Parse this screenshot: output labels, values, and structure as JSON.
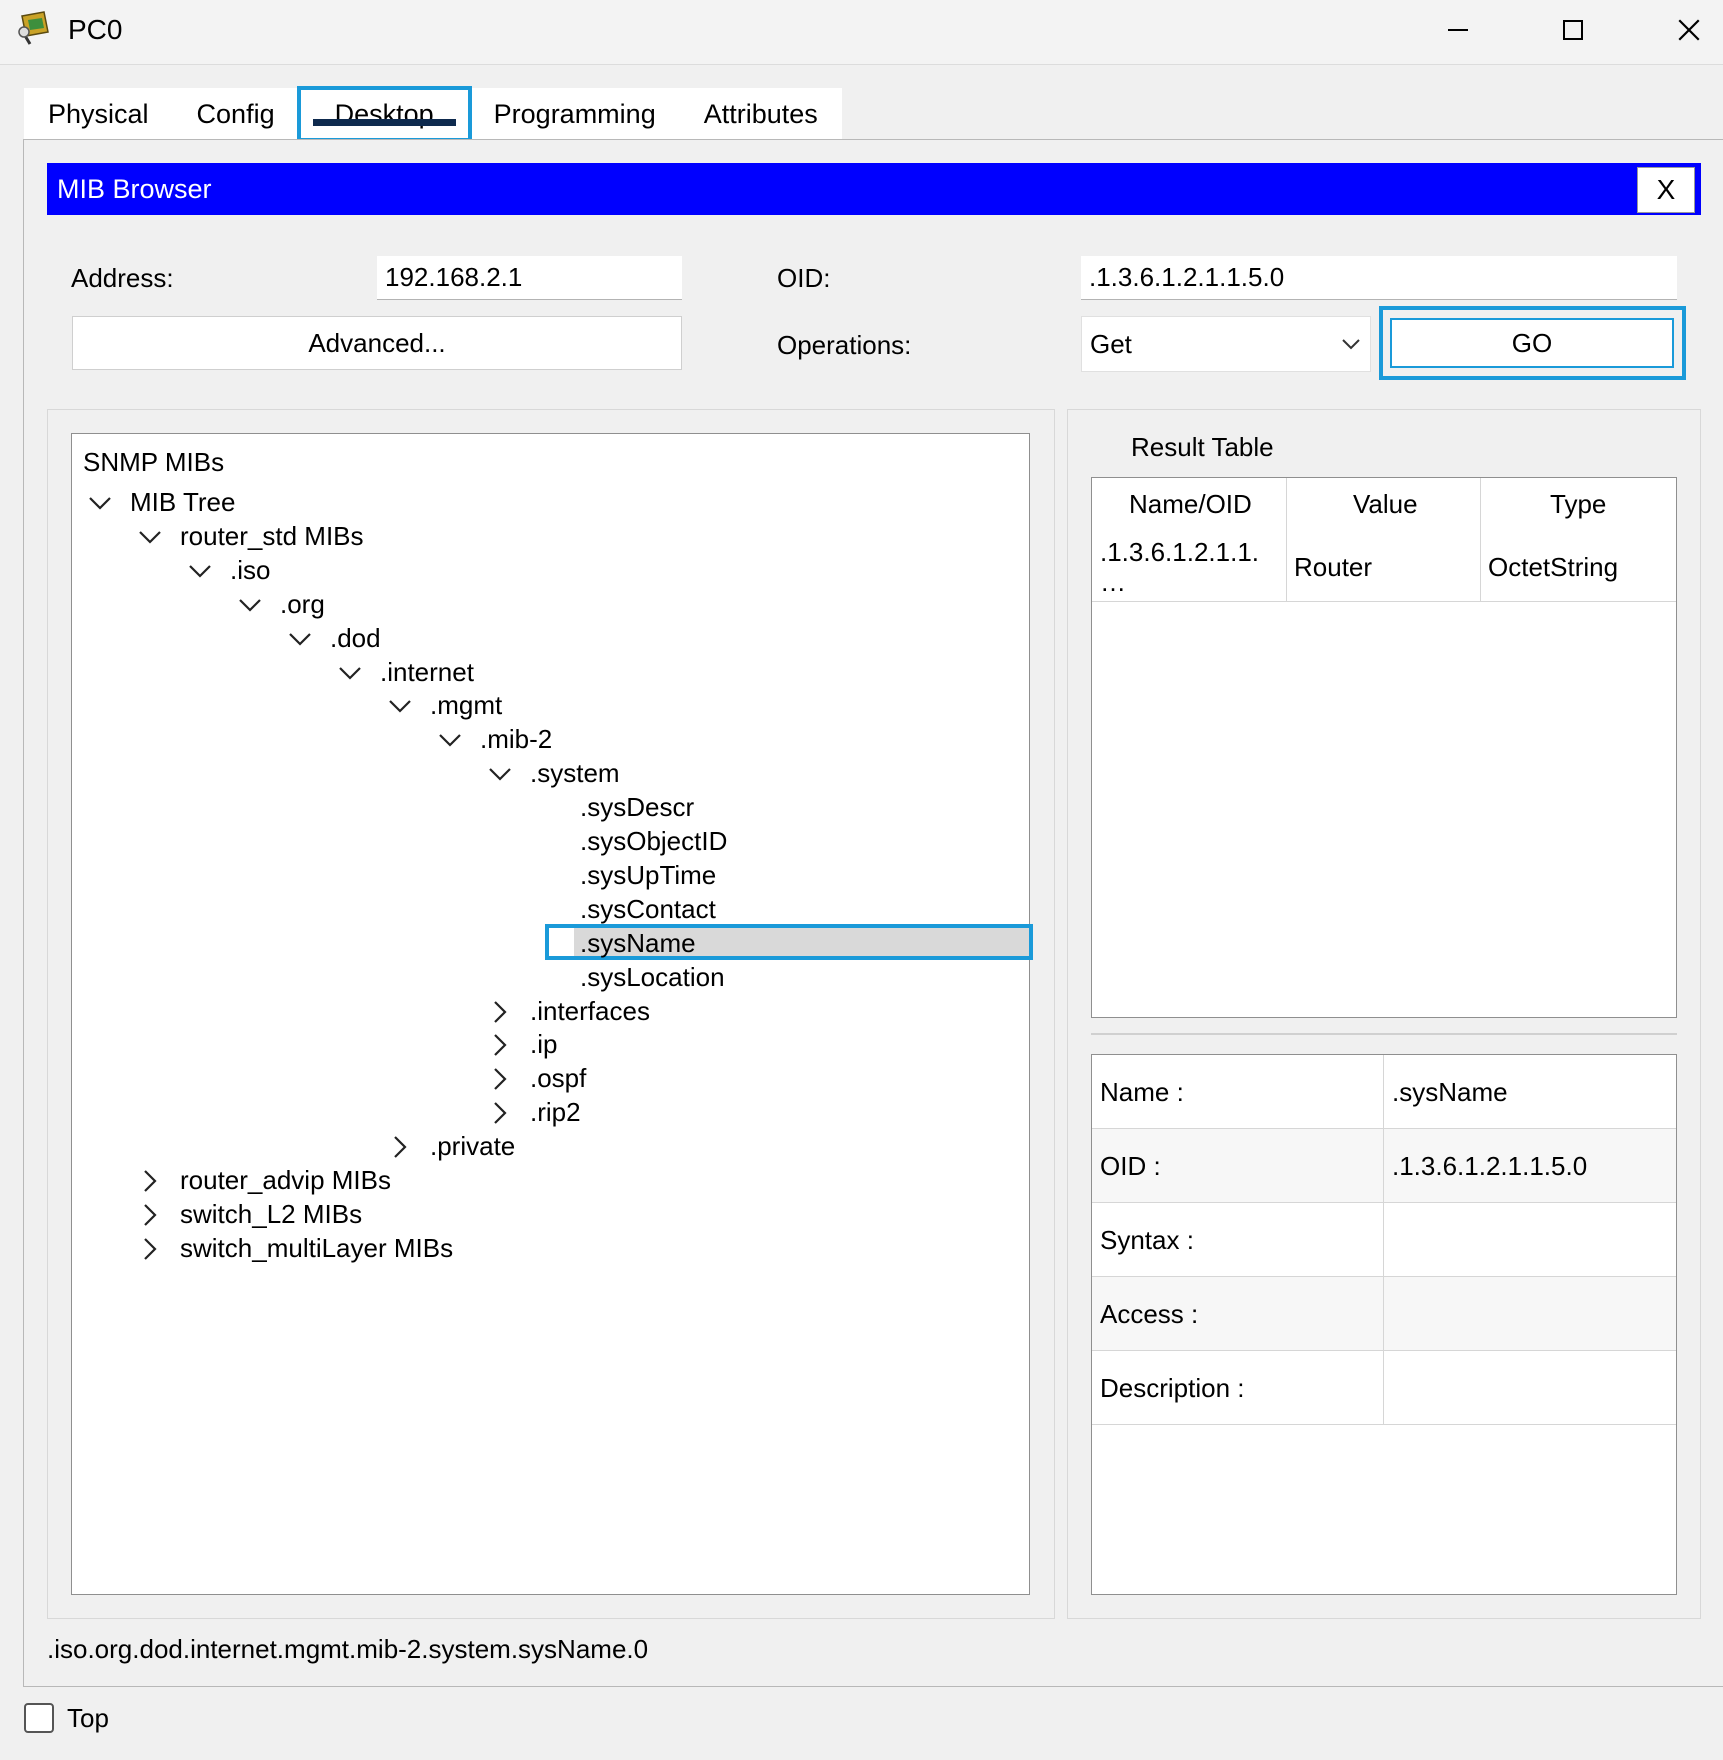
{
  "window": {
    "title": "PC0"
  },
  "tabs": [
    {
      "label": "Physical"
    },
    {
      "label": "Config"
    },
    {
      "label": "Desktop",
      "active": true
    },
    {
      "label": "Programming"
    },
    {
      "label": "Attributes"
    }
  ],
  "mib_browser": {
    "title": "MIB Browser",
    "close_label": "X",
    "address_label": "Address:",
    "address_value": "192.168.2.1",
    "oid_label": "OID:",
    "oid_value": ".1.3.6.1.2.1.1.5.0",
    "advanced_label": "Advanced...",
    "operations_label": "Operations:",
    "operation_selected": "Get",
    "go_label": "GO"
  },
  "tree": {
    "root_label": "SNMP MIBs",
    "nodes": [
      {
        "label": "MIB Tree",
        "state": "expanded"
      },
      {
        "label": "router_std MIBs",
        "state": "expanded"
      },
      {
        "label": ".iso",
        "state": "expanded"
      },
      {
        "label": ".org",
        "state": "expanded"
      },
      {
        "label": ".dod",
        "state": "expanded"
      },
      {
        "label": ".internet",
        "state": "expanded"
      },
      {
        "label": ".mgmt",
        "state": "expanded"
      },
      {
        "label": ".mib-2",
        "state": "expanded"
      },
      {
        "label": ".system",
        "state": "expanded"
      },
      {
        "label": ".sysDescr",
        "state": "leaf"
      },
      {
        "label": ".sysObjectID",
        "state": "leaf"
      },
      {
        "label": ".sysUpTime",
        "state": "leaf"
      },
      {
        "label": ".sysContact",
        "state": "leaf"
      },
      {
        "label": ".sysName",
        "state": "leaf",
        "selected": true
      },
      {
        "label": ".sysLocation",
        "state": "leaf"
      },
      {
        "label": ".interfaces",
        "state": "collapsed"
      },
      {
        "label": ".ip",
        "state": "collapsed"
      },
      {
        "label": ".ospf",
        "state": "collapsed"
      },
      {
        "label": ".rip2",
        "state": "collapsed"
      },
      {
        "label": ".private",
        "state": "collapsed"
      },
      {
        "label": "router_advip MIBs",
        "state": "collapsed"
      },
      {
        "label": "switch_L2 MIBs",
        "state": "collapsed"
      },
      {
        "label": "switch_multiLayer MIBs",
        "state": "collapsed"
      }
    ]
  },
  "result_table": {
    "title": "Result Table",
    "headers": [
      "Name/OID",
      "Value",
      "Type"
    ],
    "rows": [
      {
        "name_line1": ".1.3.6.1.2.1.1.",
        "name_line2": "…",
        "value": "Router",
        "type": "OctetString"
      }
    ]
  },
  "details": [
    {
      "key": "Name :",
      "value": ".sysName"
    },
    {
      "key": "OID :",
      "value": ".1.3.6.1.2.1.1.5.0"
    },
    {
      "key": "Syntax :",
      "value": ""
    },
    {
      "key": "Access :",
      "value": ""
    },
    {
      "key": "Description :",
      "value": ""
    }
  ],
  "status_path": ".iso.org.dod.internet.mgmt.mib-2.system.sysName.0",
  "bottom": {
    "top_label": "Top",
    "top_checked": false
  },
  "colors": {
    "header_blue": "#0000ff",
    "highlight": "#1a9ad9",
    "selected_fill": "#d9d9d9"
  }
}
